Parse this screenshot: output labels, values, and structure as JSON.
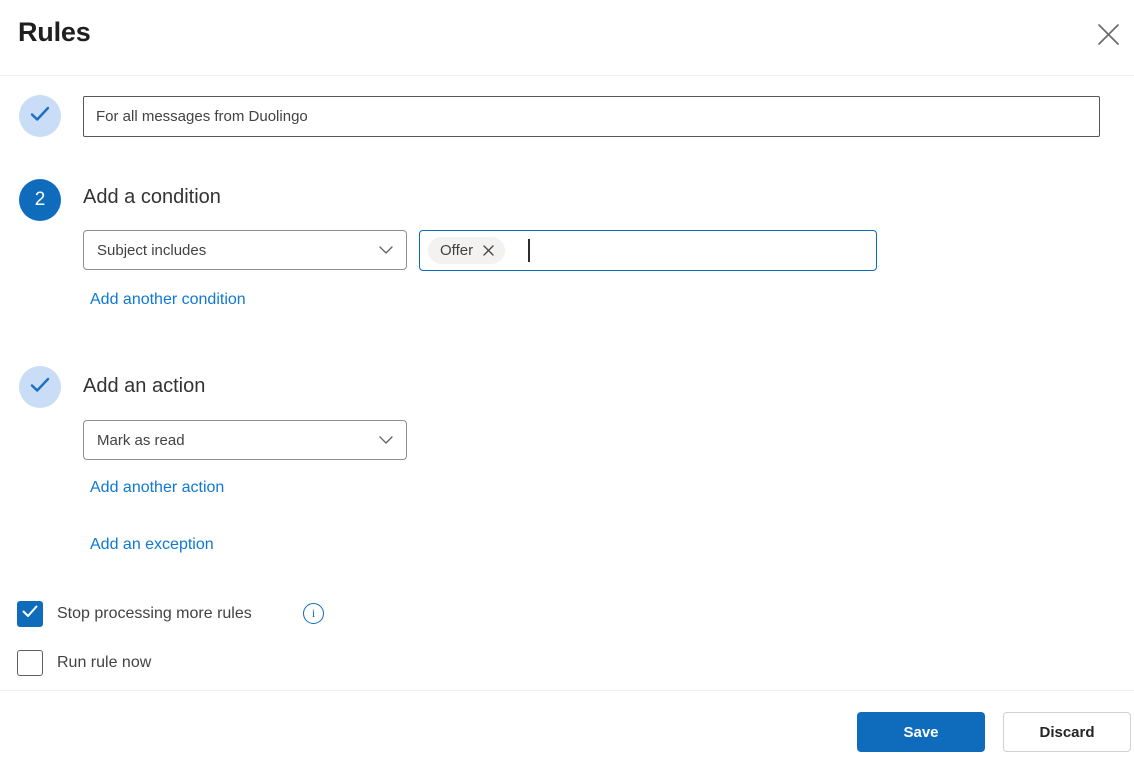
{
  "colors": {
    "primary": "#0f6cbd",
    "link": "#0f78d4",
    "step_complete_bg": "#c9ddf6",
    "chip_bg": "#f3f2f1",
    "divider": "#f0f0f0"
  },
  "dialog": {
    "title": "Rules",
    "close_icon": "close-icon"
  },
  "rule_name": {
    "value": "For all messages from Duolingo",
    "step_state": "complete",
    "step_icon": "checkmark-icon"
  },
  "condition_step": {
    "number": "2",
    "heading": "Add a condition",
    "selected": "Subject includes",
    "dropdown_icon": "chevron-down-icon",
    "keywords": [
      {
        "label": "Offer",
        "remove_icon": "dismiss-icon"
      }
    ],
    "add_link": "Add another condition"
  },
  "action_step": {
    "heading": "Add an action",
    "step_state": "complete",
    "step_icon": "checkmark-icon",
    "selected": "Mark as read",
    "dropdown_icon": "chevron-down-icon",
    "add_link": "Add another action",
    "exception_link": "Add an exception"
  },
  "options": {
    "stop_processing": {
      "label": "Stop processing more rules",
      "checked": true,
      "info_icon": "info-icon"
    },
    "run_rule_now": {
      "label": "Run rule now",
      "checked": false
    }
  },
  "footer": {
    "save": "Save",
    "discard": "Discard"
  }
}
